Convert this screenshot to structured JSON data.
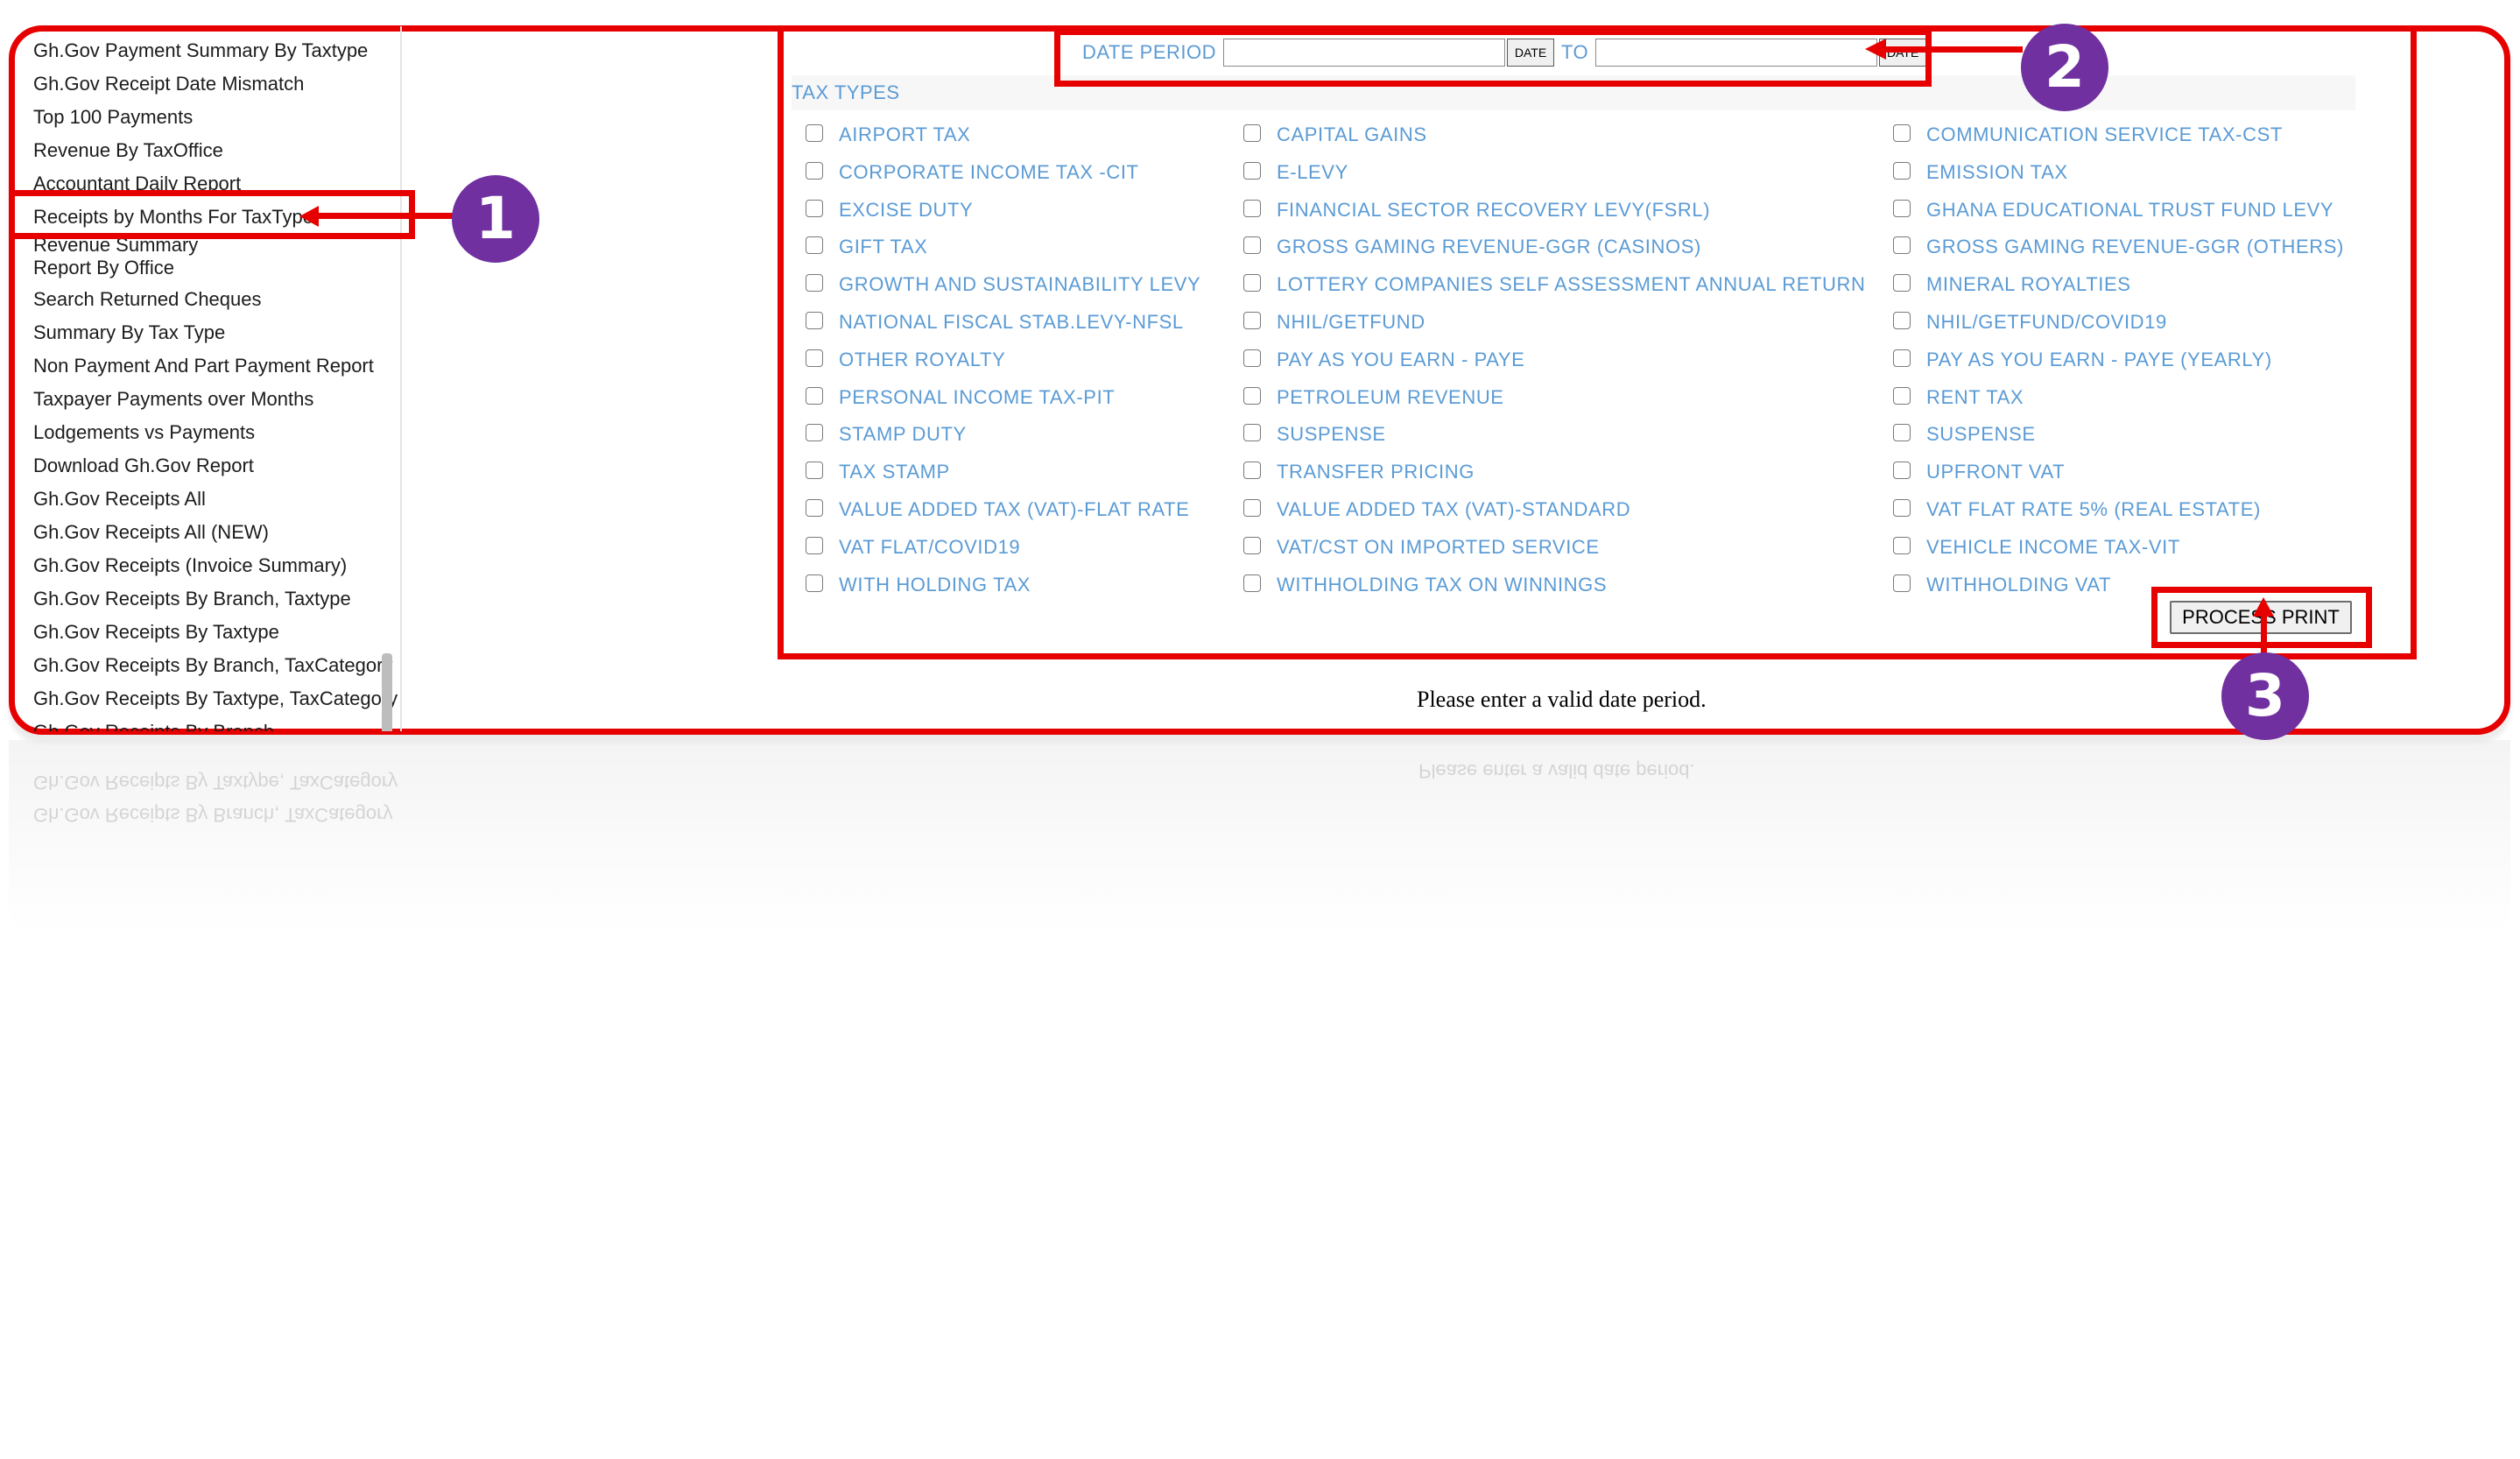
{
  "sidebar": {
    "items": [
      "Gh.Gov Payment Summary By Taxtype",
      "Gh.Gov Receipt Date Mismatch",
      "Top 100 Payments",
      "Revenue By TaxOffice",
      "Accountant Daily Report",
      "Receipts by Months For TaxType",
      "Revenue Summary",
      "Report By Office",
      "Search Returned Cheques",
      "Summary By Tax Type",
      "Non Payment And Part Payment Report",
      "Taxpayer Payments over Months",
      "Lodgements vs Payments",
      "Download Gh.Gov Report",
      "Gh.Gov Receipts All",
      "Gh.Gov Receipts All (NEW)",
      "Gh.Gov Receipts (Invoice Summary)",
      "Gh.Gov Receipts By Branch, Taxtype",
      "Gh.Gov Receipts By Taxtype",
      "Gh.Gov Receipts By Branch, TaxCategory",
      "Gh.Gov Receipts By Taxtype, TaxCategory",
      "Gh.Gov Receipts By Branch"
    ]
  },
  "form": {
    "date_period_label": "DATE PERIOD",
    "date_from_value": "",
    "date_from_button": "DATE",
    "to_label": "TO",
    "date_to_value": "",
    "date_to_button": "DATE",
    "tax_types_label": "TAX TYPES",
    "tax_types": [
      "AIRPORT TAX",
      "CAPITAL GAINS",
      "COMMUNICATION SERVICE TAX-CST",
      "CORPORATE INCOME TAX -CIT",
      "E-LEVY",
      "EMISSION TAX",
      "EXCISE DUTY",
      "FINANCIAL SECTOR RECOVERY LEVY(FSRL)",
      "GHANA EDUCATIONAL TRUST FUND LEVY",
      "GIFT TAX",
      "GROSS GAMING REVENUE-GGR (CASINOS)",
      "GROSS GAMING REVENUE-GGR (OTHERS)",
      "GROWTH AND SUSTAINABILITY LEVY",
      "LOTTERY COMPANIES SELF ASSESSMENT ANNUAL RETURN",
      "MINERAL ROYALTIES",
      "NATIONAL FISCAL STAB.LEVY-NFSL",
      "NHIL/GETFUND",
      "NHIL/GETFUND/COVID19",
      "OTHER ROYALTY",
      "PAY AS YOU EARN - PAYE",
      "PAY AS YOU EARN - PAYE (YEARLY)",
      "PERSONAL INCOME TAX-PIT",
      "PETROLEUM REVENUE",
      "RENT TAX",
      "STAMP DUTY",
      "SUSPENSE",
      "SUSPENSE",
      "TAX STAMP",
      "TRANSFER PRICING",
      "UPFRONT VAT",
      "VALUE ADDED TAX (VAT)-FLAT RATE",
      "VALUE ADDED TAX (VAT)-STANDARD",
      "VAT FLAT RATE 5% (REAL ESTATE)",
      "VAT FLAT/COVID19",
      "VAT/CST ON IMPORTED SERVICE",
      "VEHICLE INCOME TAX-VIT",
      "WITH HOLDING TAX",
      "WITHHOLDING TAX ON WINNINGS",
      "WITHHOLDING VAT"
    ],
    "process_button": "PROCESS PRINT",
    "message": "Please enter a valid date period."
  },
  "annotations": {
    "badge_1": "1",
    "badge_2": "2",
    "badge_3": "3"
  },
  "colors": {
    "annotation_red": "#e60000",
    "badge_purple": "#7030a0",
    "label_blue": "#5b9bd5"
  }
}
